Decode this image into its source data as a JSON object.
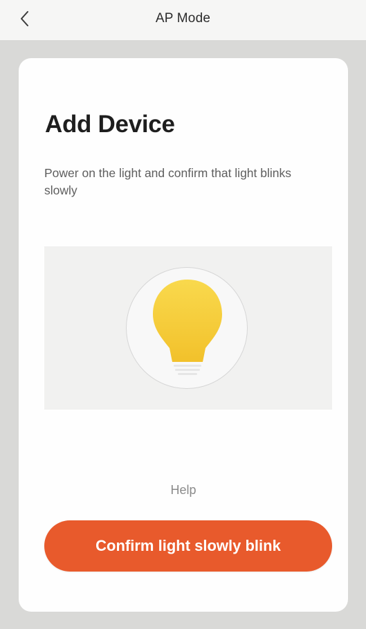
{
  "header": {
    "title": "AP Mode",
    "back_icon": "chevron-left-icon"
  },
  "card": {
    "heading": "Add Device",
    "description": "Power on the light and confirm that light blinks slowly",
    "illustration_icon": "lightbulb-icon",
    "help_label": "Help",
    "confirm_label": "Confirm light slowly blink"
  },
  "colors": {
    "accent": "#e85a2c",
    "bulb": "#f7cf3a",
    "background": "#d9d9d7",
    "card": "#fefefe"
  }
}
